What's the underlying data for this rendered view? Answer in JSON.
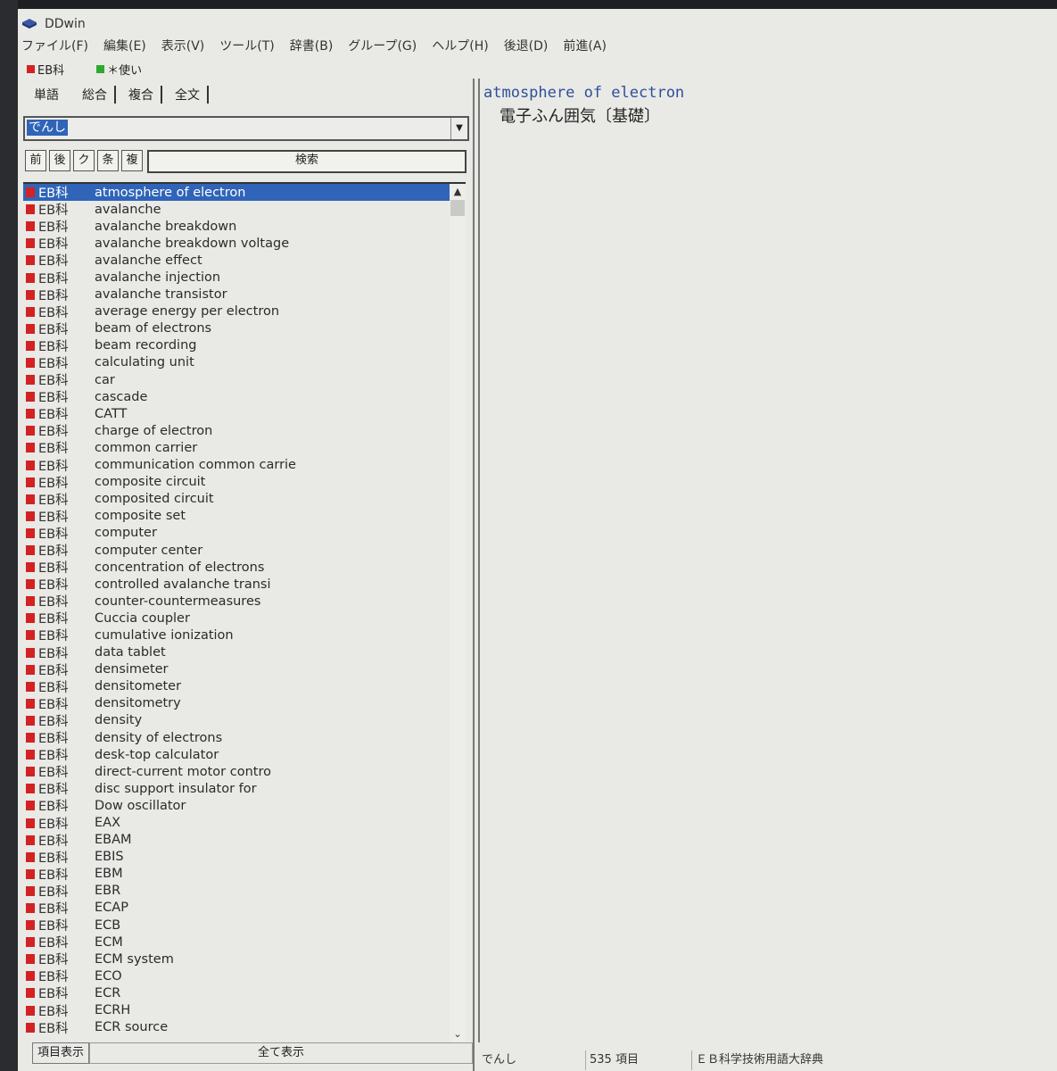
{
  "window": {
    "title": "DDwin",
    "menu": [
      "ファイル(F)",
      "編集(E)",
      "表示(V)",
      "ツール(T)",
      "辞書(B)",
      "グループ(G)",
      "ヘルプ(H)",
      "後退(D)",
      "前進(A)"
    ]
  },
  "dict_bar": {
    "items": [
      {
        "label": "EB科",
        "color": "#d32222"
      },
      {
        "label": "＊使い",
        "color": "#2ea82e"
      }
    ]
  },
  "left": {
    "tabs": [
      "単語",
      "総合",
      "複合",
      "全文"
    ],
    "search_value": "でんし",
    "nav": [
      "前",
      "後",
      "ク",
      "条",
      "複"
    ],
    "search_button": "検索",
    "rows": [
      {
        "dict": "EB科",
        "word": "atmosphere of electron"
      },
      {
        "dict": "EB科",
        "word": "avalanche"
      },
      {
        "dict": "EB科",
        "word": "avalanche breakdown"
      },
      {
        "dict": "EB科",
        "word": "avalanche breakdown voltage"
      },
      {
        "dict": "EB科",
        "word": "avalanche effect"
      },
      {
        "dict": "EB科",
        "word": "avalanche injection"
      },
      {
        "dict": "EB科",
        "word": "avalanche transistor"
      },
      {
        "dict": "EB科",
        "word": "average energy per electron"
      },
      {
        "dict": "EB科",
        "word": "beam of electrons"
      },
      {
        "dict": "EB科",
        "word": "beam recording"
      },
      {
        "dict": "EB科",
        "word": "calculating unit"
      },
      {
        "dict": "EB科",
        "word": "car"
      },
      {
        "dict": "EB科",
        "word": "cascade"
      },
      {
        "dict": "EB科",
        "word": "CATT"
      },
      {
        "dict": "EB科",
        "word": "charge of electron"
      },
      {
        "dict": "EB科",
        "word": "common carrier"
      },
      {
        "dict": "EB科",
        "word": "communication common carrie"
      },
      {
        "dict": "EB科",
        "word": "composite circuit"
      },
      {
        "dict": "EB科",
        "word": "composited circuit"
      },
      {
        "dict": "EB科",
        "word": "composite set"
      },
      {
        "dict": "EB科",
        "word": "computer"
      },
      {
        "dict": "EB科",
        "word": "computer center"
      },
      {
        "dict": "EB科",
        "word": "concentration of electrons"
      },
      {
        "dict": "EB科",
        "word": "controlled avalanche transi"
      },
      {
        "dict": "EB科",
        "word": "counter-countermeasures"
      },
      {
        "dict": "EB科",
        "word": "Cuccia coupler"
      },
      {
        "dict": "EB科",
        "word": "cumulative ionization"
      },
      {
        "dict": "EB科",
        "word": "data tablet"
      },
      {
        "dict": "EB科",
        "word": "densimeter"
      },
      {
        "dict": "EB科",
        "word": "densitometer"
      },
      {
        "dict": "EB科",
        "word": "densitometry"
      },
      {
        "dict": "EB科",
        "word": "density"
      },
      {
        "dict": "EB科",
        "word": "density of electrons"
      },
      {
        "dict": "EB科",
        "word": "desk-top calculator"
      },
      {
        "dict": "EB科",
        "word": "direct-current motor contro"
      },
      {
        "dict": "EB科",
        "word": "disc support insulator for"
      },
      {
        "dict": "EB科",
        "word": "Dow oscillator"
      },
      {
        "dict": "EB科",
        "word": "EAX"
      },
      {
        "dict": "EB科",
        "word": "EBAM"
      },
      {
        "dict": "EB科",
        "word": "EBIS"
      },
      {
        "dict": "EB科",
        "word": "EBM"
      },
      {
        "dict": "EB科",
        "word": "EBR"
      },
      {
        "dict": "EB科",
        "word": "ECAP"
      },
      {
        "dict": "EB科",
        "word": "ECB"
      },
      {
        "dict": "EB科",
        "word": "ECM"
      },
      {
        "dict": "EB科",
        "word": "ECM system"
      },
      {
        "dict": "EB科",
        "word": "ECO"
      },
      {
        "dict": "EB科",
        "word": "ECR"
      },
      {
        "dict": "EB科",
        "word": "ECRH"
      },
      {
        "dict": "EB科",
        "word": "ECR source"
      }
    ],
    "footer": {
      "item_display": "項目表示",
      "show_all": "全て表示"
    }
  },
  "right": {
    "entry_title": "atmosphere of electron",
    "entry_body": "電子ふん囲気〔基礎〕"
  },
  "status": {
    "query": "でんし",
    "count": "535 項目",
    "dictionary": "ＥＢ科学技術用語大辞典"
  }
}
